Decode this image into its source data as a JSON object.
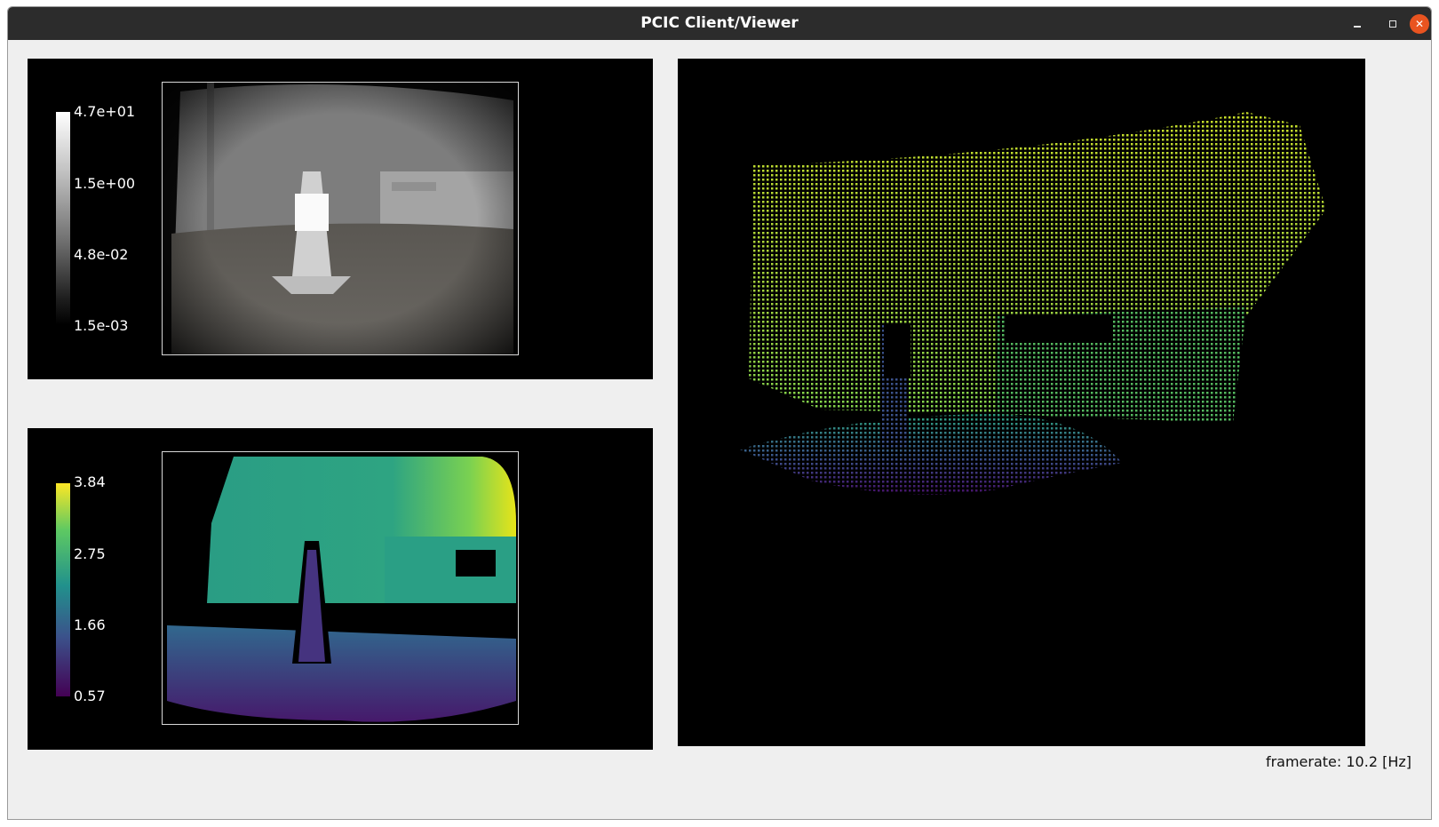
{
  "window": {
    "title": "PCIC Client/Viewer"
  },
  "amplitude": {
    "colormap": "gray",
    "ticks": [
      "4.7e+01",
      "1.5e+00",
      "4.8e-02",
      "1.5e-03"
    ]
  },
  "distance": {
    "colormap": "viridis",
    "ticks": [
      "3.84",
      "2.75",
      "1.66",
      "0.57"
    ]
  },
  "point_cloud": {
    "colormap": "viridis"
  },
  "status": {
    "framerate": "framerate: 10.2 [Hz]"
  },
  "colors": {
    "titlebar": "#2c2c2c",
    "close_button": "#e95420",
    "window_bg": "#efefef",
    "panel_bg": "#000000"
  }
}
